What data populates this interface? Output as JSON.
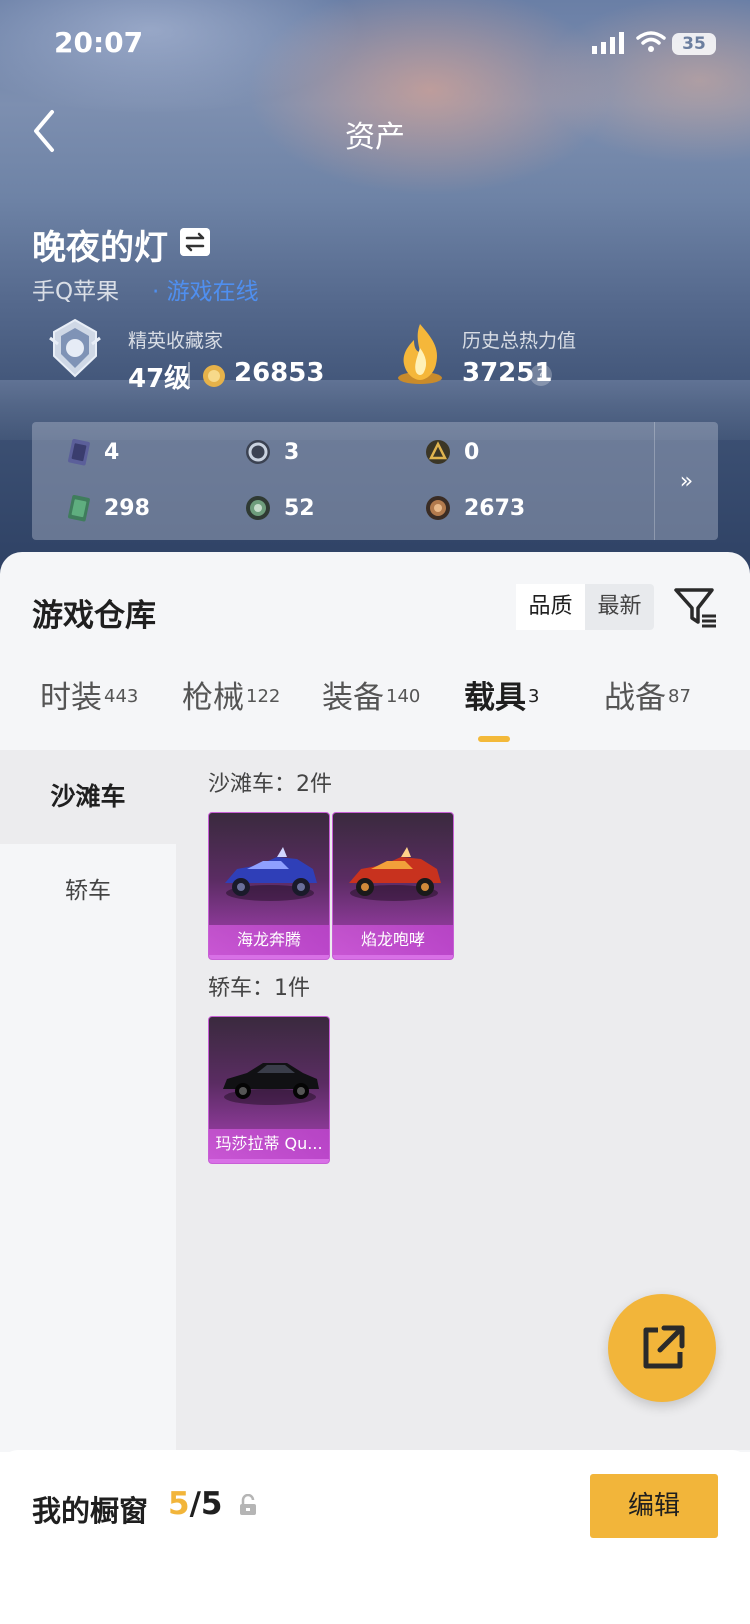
{
  "status_bar": {
    "time": "20:07",
    "battery": "35"
  },
  "nav": {
    "title": "资产"
  },
  "profile": {
    "name": "晚夜的灯",
    "platform": "手Q苹果",
    "status": "· 游戏在线",
    "rank_title": "精英收藏家",
    "rank_level": "47级",
    "coins": "26853",
    "heat_title": "历史总热力值",
    "heat_value": "37251",
    "help_icon": "?"
  },
  "stats": [
    {
      "icon": "card-purple-icon",
      "value": "4"
    },
    {
      "icon": "emblem-silver-icon",
      "value": "3"
    },
    {
      "icon": "emblem-gold-icon",
      "value": "0"
    },
    {
      "icon": "card-green-icon",
      "value": "298"
    },
    {
      "icon": "emblem-green-icon",
      "value": "52"
    },
    {
      "icon": "emblem-bronze-icon",
      "value": "2673"
    }
  ],
  "stats_more_label": "»",
  "warehouse": {
    "title": "游戏仓库",
    "sort_quality": "品质",
    "sort_newest": "最新",
    "tabs": [
      {
        "label": "时装",
        "count": "443"
      },
      {
        "label": "枪械",
        "count": "122"
      },
      {
        "label": "装备",
        "count": "140"
      },
      {
        "label": "载具",
        "count": "3"
      },
      {
        "label": "战备",
        "count": "87"
      }
    ],
    "categories": [
      "沙滩车",
      "轿车"
    ],
    "groups": [
      {
        "title": "沙滩车：2件",
        "items": [
          "海龙奔腾",
          "焰龙咆哮"
        ]
      },
      {
        "title": "轿车：1件",
        "items": [
          "玛莎拉蒂 Qu..."
        ]
      }
    ]
  },
  "showcase": {
    "label": "我的橱窗",
    "current": "5",
    "total": "/5",
    "edit_label": "编辑"
  },
  "colors": {
    "accent": "#f2b53a",
    "online": "#4f8ff0",
    "card_purple": "#8e3a9a"
  }
}
